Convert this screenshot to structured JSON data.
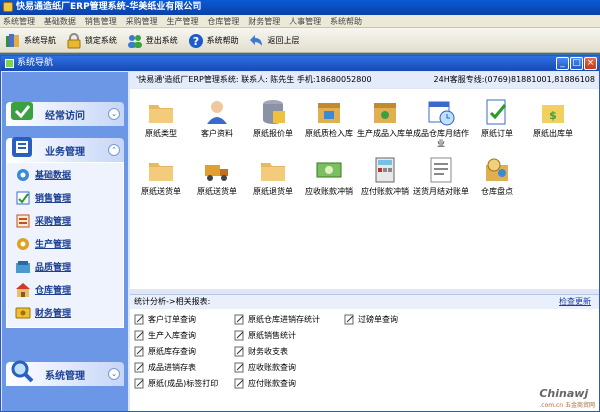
{
  "app": {
    "title": "快易通造纸厂ERP管理系统-华美纸业有限公司"
  },
  "menubar": [
    "系统管理",
    "基础数据",
    "销售管理",
    "采购管理",
    "生产管理",
    "仓库管理",
    "财务管理",
    "人事管理",
    "系统帮助"
  ],
  "toolbar": [
    {
      "label": "系统导航",
      "icon": "navigation-icon"
    },
    {
      "label": "锁定系统",
      "icon": "lock-icon"
    },
    {
      "label": "登出系统",
      "icon": "users-logout-icon"
    },
    {
      "label": "系统帮助",
      "icon": "help-icon"
    },
    {
      "label": "返回上层",
      "icon": "back-arrow-icon"
    }
  ],
  "window": {
    "title": "系统导航"
  },
  "sidebar": {
    "frequent": "经常访问",
    "business": "业务管理",
    "system": "系统管理",
    "items": [
      "基础数据",
      "销售管理",
      "采购管理",
      "生产管理",
      "品质管理",
      "仓库管理",
      "财务管理"
    ]
  },
  "info": {
    "left": "'快易通'造纸厂ERP管理系统: 联系人: 陈先生 手机:18680052800",
    "right": "24H客服专线:(0769)81881001,81886108"
  },
  "tiles": [
    "原纸类型",
    "客户资料",
    "原纸报价单",
    "原纸质检入库",
    "生产成品入库单",
    "成品仓库月结作业",
    "原纸订单",
    "原纸出库单",
    "原纸送货单",
    "原纸送货单",
    "原纸退货单",
    "应收账款冲销",
    "应付账款冲销",
    "送货月结对账单",
    "仓库盘点"
  ],
  "stats": {
    "title": "统计分析->相关报表:",
    "refresh": "检查更新",
    "reports": [
      [
        "客户订单查询",
        "生产入库查询",
        "原纸库存查询",
        "成品进销存表",
        "原纸(成品)标签打印"
      ],
      [
        "原纸仓库进销存统计",
        "原纸销售统计",
        "财务收支表",
        "应收账款查询",
        "应付账款查询"
      ],
      [
        "过磅单查询"
      ]
    ]
  },
  "watermark": {
    "brand": "Chinawj",
    "sub": ".com.cn 五金商贸网"
  }
}
